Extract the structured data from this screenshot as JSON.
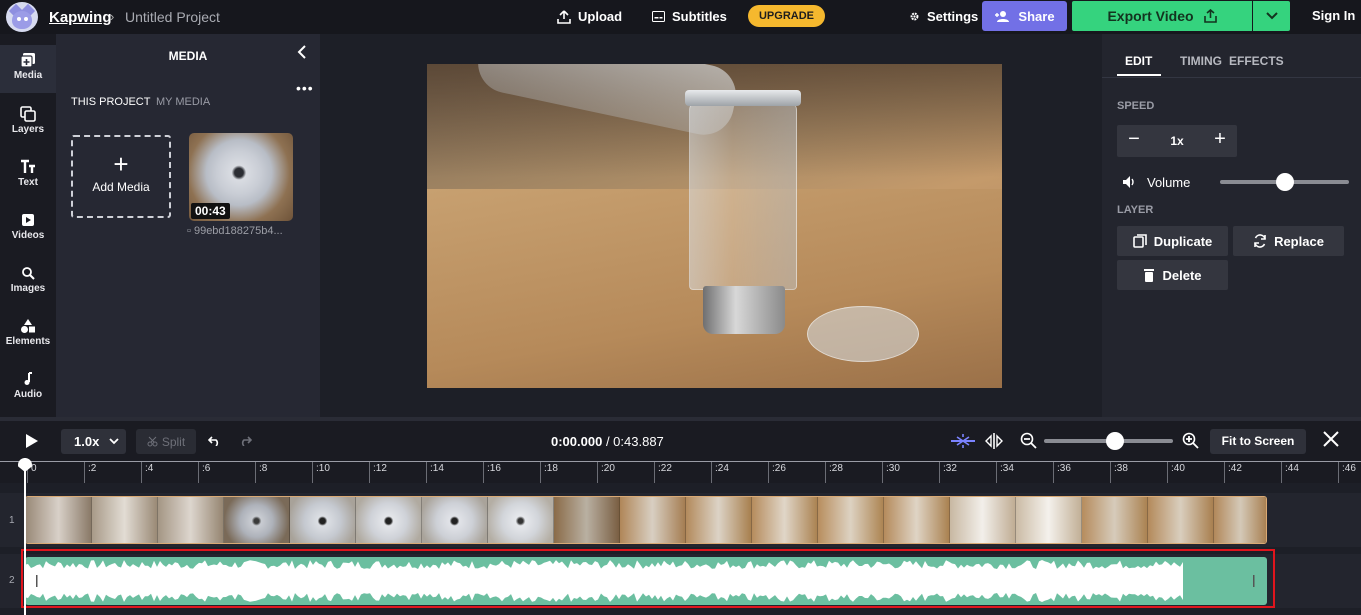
{
  "topbar": {
    "brand": "Kapwing",
    "crumb_sep": "›",
    "project_title": "Untitled Project",
    "upload_label": "Upload",
    "subtitles_label": "Subtitles",
    "upgrade_label": "UPGRADE",
    "settings_label": "Settings",
    "share_label": "Share",
    "export_label": "Export Video",
    "signin_label": "Sign In"
  },
  "leftnav": {
    "items": [
      {
        "label": "Media",
        "icon": "media-icon"
      },
      {
        "label": "Layers",
        "icon": "layers-icon"
      },
      {
        "label": "Text",
        "icon": "text-icon"
      },
      {
        "label": "Videos",
        "icon": "videos-icon"
      },
      {
        "label": "Images",
        "icon": "images-icon"
      },
      {
        "label": "Elements",
        "icon": "elements-icon"
      },
      {
        "label": "Audio",
        "icon": "audio-icon"
      }
    ]
  },
  "media": {
    "title": "MEDIA",
    "tabs": [
      "THIS PROJECT",
      "MY MEDIA"
    ],
    "add_media_label": "Add Media",
    "items": [
      {
        "duration": "00:43",
        "filename": "▫ 99ebd188275b4..."
      }
    ]
  },
  "rightpanel": {
    "tabs": [
      "EDIT",
      "TIMING",
      "EFFECTS"
    ],
    "speed_label": "SPEED",
    "speed_value": "1x",
    "volume_label": "Volume",
    "volume_level": 0.5,
    "layer_label": "LAYER",
    "duplicate_label": "Duplicate",
    "replace_label": "Replace",
    "delete_label": "Delete"
  },
  "controls": {
    "speed": "1.0x",
    "split_label": "Split",
    "current_time": "0:00.000",
    "time_sep": " / ",
    "total_time": "0:43.887",
    "zoom_level": 0.55,
    "fit_label": "Fit to Screen"
  },
  "timeline": {
    "ticks": [
      "0",
      ":2",
      ":4",
      ":6",
      ":8",
      ":10",
      ":12",
      ":14",
      ":16",
      ":18",
      ":20",
      ":22",
      ":24",
      ":26",
      ":28",
      ":30",
      ":32",
      ":34",
      ":36",
      ":38",
      ":40",
      ":42",
      ":44",
      ":46"
    ],
    "track_numbers": [
      "1",
      "2"
    ]
  },
  "colors": {
    "accent_export": "#35d37e",
    "accent_share": "#7270e6",
    "upgrade": "#f5b82e",
    "audio_wave": "#6bbfa0",
    "highlight": "#e0151d"
  }
}
